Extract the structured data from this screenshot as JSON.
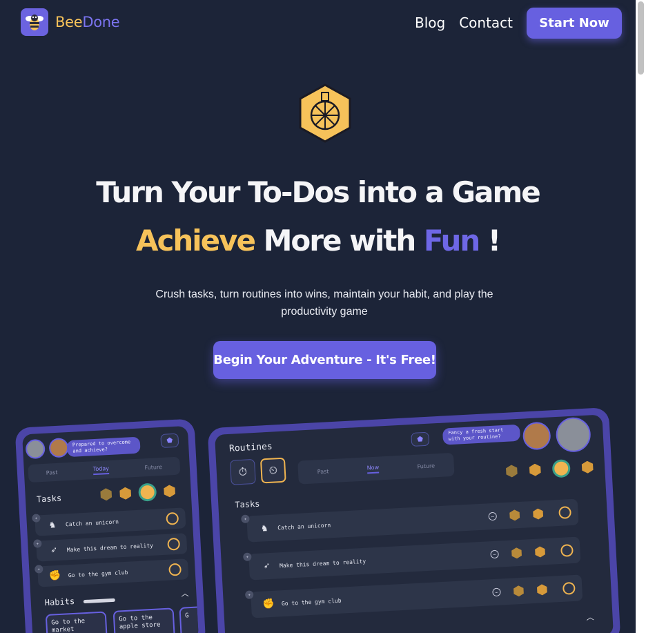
{
  "brand": {
    "name_part1": "Bee",
    "name_part2": "Done"
  },
  "nav": {
    "blog": "Blog",
    "contact": "Contact",
    "start": "Start Now"
  },
  "hero": {
    "line1": "Turn Your To-Dos into a Game",
    "line2_a": "Achieve",
    "line2_b": " More with ",
    "line2_c": "Fun",
    "line2_d": " !",
    "subtitle": "Crush tasks, turn routines into wins, maintain your habit, and play the productivity game",
    "cta": "Begin Your Adventure - It's Free!"
  },
  "left_preview": {
    "bubble": "Prepared to overcome and achieve?",
    "tabs": [
      "Past",
      "Today",
      "Future"
    ],
    "active_tab": "Today",
    "tasks_title": "Tasks",
    "tasks": [
      "Catch an unicorn",
      "Make this dream to reality",
      "Go to the gym club"
    ],
    "habits_title": "Habits",
    "habits": [
      "Go to the market",
      "Go to the apple store",
      "G"
    ]
  },
  "right_preview": {
    "title": "Routines",
    "bubble": "Fancy a fresh start with your routine?",
    "tabs": [
      "Past",
      "Now",
      "Future"
    ],
    "active_tab": "Now",
    "tasks_title": "Tasks",
    "tasks": [
      "Catch an unicorn",
      "Make this dream to reality",
      "Go to the gym club"
    ]
  },
  "colors": {
    "background": "#1c2438",
    "accent": "#6760e0",
    "gold": "#f6c25a"
  }
}
